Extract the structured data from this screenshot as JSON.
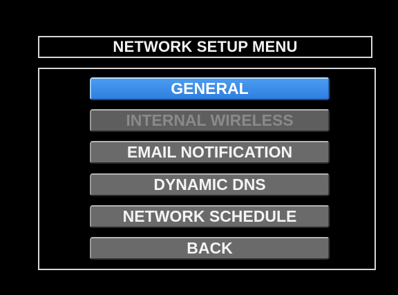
{
  "title": "NETWORK SETUP MENU",
  "menu": {
    "items": [
      {
        "label": "GENERAL",
        "state": "selected"
      },
      {
        "label": "INTERNAL WIRELESS",
        "state": "disabled"
      },
      {
        "label": "EMAIL NOTIFICATION",
        "state": "normal"
      },
      {
        "label": "DYNAMIC DNS",
        "state": "normal"
      },
      {
        "label": "NETWORK SCHEDULE",
        "state": "normal"
      },
      {
        "label": "BACK",
        "state": "normal"
      }
    ]
  },
  "colors": {
    "background": "#000000",
    "selected": "#3b8de8",
    "button": "#6a6a6a",
    "disabled_text": "#8a8a8a",
    "frame": "#d8d8d8"
  }
}
